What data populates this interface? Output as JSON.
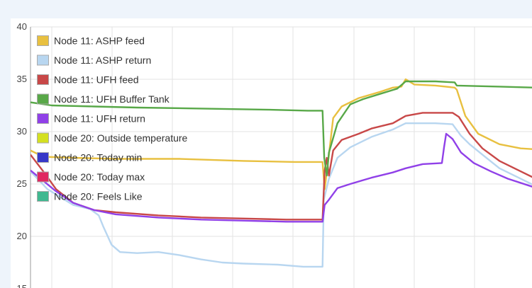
{
  "chart_data": {
    "type": "line",
    "title": "",
    "xlabel": "",
    "ylabel": "",
    "ylim": [
      15,
      40
    ],
    "xlim": [
      0,
      100
    ],
    "yticks": [
      15,
      20,
      25,
      30,
      35,
      40
    ],
    "grid": true,
    "legend_position": "top-left",
    "series": [
      {
        "name": "Node 11: ASHP feed",
        "color": "#e8c040",
        "points": [
          [
            0,
            28.2
          ],
          [
            3,
            27.6
          ],
          [
            10,
            27.5
          ],
          [
            20,
            27.4
          ],
          [
            35,
            27.4
          ],
          [
            50,
            27.2
          ],
          [
            62,
            27.1
          ],
          [
            68.5,
            27.1
          ],
          [
            69,
            24.5
          ],
          [
            70,
            27.8
          ],
          [
            71,
            31.3
          ],
          [
            73,
            32.4
          ],
          [
            77,
            33.2
          ],
          [
            82,
            33.8
          ],
          [
            85,
            34.2
          ],
          [
            87,
            34.3
          ],
          [
            88,
            35.0
          ],
          [
            90,
            34.5
          ],
          [
            95,
            34.4
          ],
          [
            99.5,
            34.2
          ],
          [
            100,
            34.0
          ],
          [
            102,
            31.5
          ],
          [
            105,
            29.8
          ],
          [
            110,
            28.8
          ],
          [
            115,
            28.4
          ],
          [
            119,
            28.3
          ],
          [
            122,
            28.3
          ],
          [
            124.5,
            28.5
          ]
        ]
      },
      {
        "name": "Node 11: ASHP return",
        "color": "#b8d6f0",
        "points": [
          [
            0,
            26.2
          ],
          [
            4,
            24.5
          ],
          [
            8,
            23.5
          ],
          [
            10,
            23.0
          ],
          [
            14,
            22.6
          ],
          [
            16,
            22.0
          ],
          [
            17,
            21.0
          ],
          [
            19,
            19.2
          ],
          [
            21,
            18.5
          ],
          [
            25,
            18.4
          ],
          [
            30,
            18.5
          ],
          [
            35,
            18.2
          ],
          [
            40,
            17.8
          ],
          [
            45,
            17.5
          ],
          [
            50,
            17.4
          ],
          [
            58,
            17.3
          ],
          [
            64,
            17.1
          ],
          [
            68.5,
            17.1
          ],
          [
            68.8,
            23.5
          ],
          [
            70,
            25.5
          ],
          [
            72,
            27.5
          ],
          [
            75,
            28.5
          ],
          [
            80,
            29.5
          ],
          [
            85,
            30.2
          ],
          [
            88,
            30.8
          ],
          [
            95,
            30.8
          ],
          [
            99,
            30.7
          ],
          [
            101,
            29.6
          ],
          [
            103,
            28.8
          ],
          [
            106,
            27.8
          ],
          [
            110,
            26.5
          ],
          [
            115,
            25.5
          ],
          [
            120,
            24.5
          ],
          [
            124.5,
            24.1
          ]
        ]
      },
      {
        "name": "Node 11: UFH feed",
        "color": "#c84848",
        "points": [
          [
            0,
            27.8
          ],
          [
            3,
            26.2
          ],
          [
            6,
            24.5
          ],
          [
            10,
            23.2
          ],
          [
            15,
            22.5
          ],
          [
            20,
            22.3
          ],
          [
            30,
            22.0
          ],
          [
            40,
            21.8
          ],
          [
            50,
            21.7
          ],
          [
            60,
            21.6
          ],
          [
            68.5,
            21.6
          ],
          [
            69,
            26.3
          ],
          [
            69.5,
            27.5
          ],
          [
            70,
            25.8
          ],
          [
            71,
            28.2
          ],
          [
            73,
            29.2
          ],
          [
            77,
            29.8
          ],
          [
            80,
            30.3
          ],
          [
            85,
            30.8
          ],
          [
            88,
            31.5
          ],
          [
            92,
            31.8
          ],
          [
            99,
            31.8
          ],
          [
            100.5,
            31.4
          ],
          [
            103,
            29.8
          ],
          [
            106,
            28.4
          ],
          [
            110,
            27.2
          ],
          [
            115,
            26.2
          ],
          [
            120,
            25.2
          ],
          [
            124.5,
            24.6
          ]
        ]
      },
      {
        "name": "Node 11: UFH Buffer Tank",
        "color": "#58a848",
        "points": [
          [
            0,
            32.8
          ],
          [
            5,
            32.5
          ],
          [
            15,
            32.4
          ],
          [
            25,
            32.3
          ],
          [
            40,
            32.2
          ],
          [
            55,
            32.1
          ],
          [
            65,
            32.0
          ],
          [
            68.5,
            32.0
          ],
          [
            68.9,
            27.5
          ],
          [
            69.5,
            25.8
          ],
          [
            70,
            28.0
          ],
          [
            72,
            30.8
          ],
          [
            75,
            32.6
          ],
          [
            78,
            33.1
          ],
          [
            82,
            33.6
          ],
          [
            86,
            34.1
          ],
          [
            88,
            34.8
          ],
          [
            95,
            34.8
          ],
          [
            99.5,
            34.7
          ],
          [
            100,
            34.4
          ],
          [
            110,
            34.3
          ],
          [
            118,
            34.2
          ],
          [
            124.5,
            34.1
          ]
        ]
      },
      {
        "name": "Node 11: UFH return",
        "color": "#9040e8",
        "points": [
          [
            0,
            26.3
          ],
          [
            3,
            25.3
          ],
          [
            6,
            24.3
          ],
          [
            10,
            23.2
          ],
          [
            15,
            22.5
          ],
          [
            20,
            22.1
          ],
          [
            30,
            21.8
          ],
          [
            40,
            21.6
          ],
          [
            50,
            21.5
          ],
          [
            60,
            21.4
          ],
          [
            68.5,
            21.4
          ],
          [
            69,
            23.0
          ],
          [
            70,
            23.5
          ],
          [
            72,
            24.6
          ],
          [
            75,
            25.0
          ],
          [
            80,
            25.6
          ],
          [
            85,
            26.1
          ],
          [
            88,
            26.5
          ],
          [
            92,
            26.9
          ],
          [
            96.5,
            27.0
          ],
          [
            97,
            28.5
          ],
          [
            97.5,
            29.8
          ],
          [
            99,
            29.3
          ],
          [
            101,
            28.0
          ],
          [
            104,
            27.0
          ],
          [
            108,
            26.2
          ],
          [
            112,
            25.5
          ],
          [
            118,
            24.7
          ],
          [
            124.5,
            24.0
          ]
        ]
      },
      {
        "name": "Node 20: Outside temperature",
        "color": "#d4e020",
        "points": []
      },
      {
        "name": "Node 20: Today min",
        "color": "#3838c8",
        "points": []
      },
      {
        "name": "Node 20: Today max",
        "color": "#e02860",
        "points": []
      },
      {
        "name": "Node 20: Feels Like",
        "color": "#40b890",
        "points": []
      }
    ]
  }
}
